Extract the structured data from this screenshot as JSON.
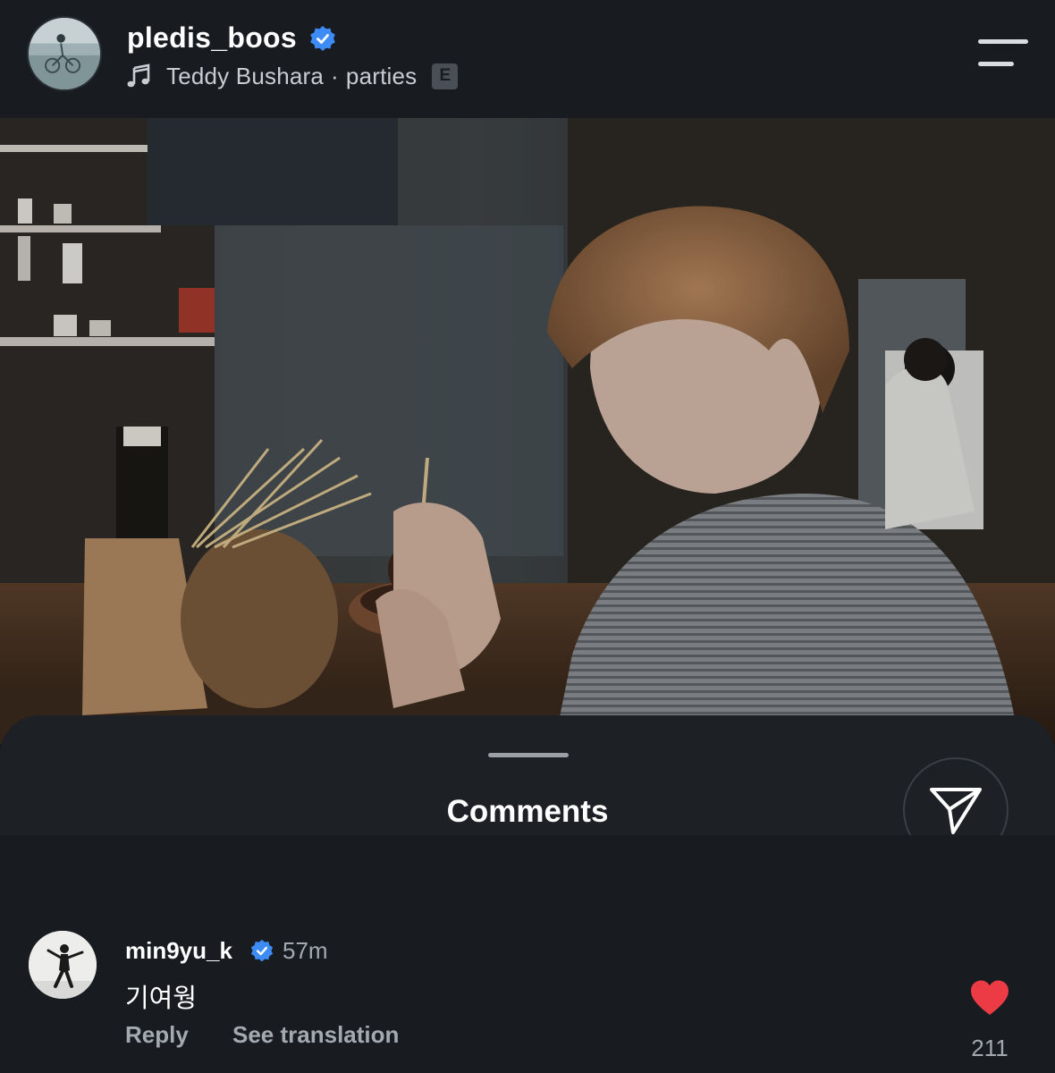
{
  "header": {
    "username": "pledis_boos",
    "verified": true,
    "music": {
      "artist": "Teddy Bushara",
      "separator": "·",
      "song": "parties",
      "explicit_label": "E"
    }
  },
  "post": {
    "image_alt": ""
  },
  "comments_sheet": {
    "title": "Comments",
    "comments": [
      {
        "username": "min9yu_k",
        "verified": true,
        "time": "57m",
        "text": "기여웡",
        "reply_label": "Reply",
        "translate_label": "See translation",
        "likes": "211"
      }
    ]
  },
  "colors": {
    "background": "#181c21",
    "sheet": "#1d2126",
    "verified_blue": "#3d8cf5",
    "like_red": "#ed3b45",
    "muted_text": "#a4a9af"
  },
  "icons": [
    "music-note-icon",
    "verified-badge-icon",
    "menu-icon",
    "share-send-icon",
    "heart-icon"
  ]
}
